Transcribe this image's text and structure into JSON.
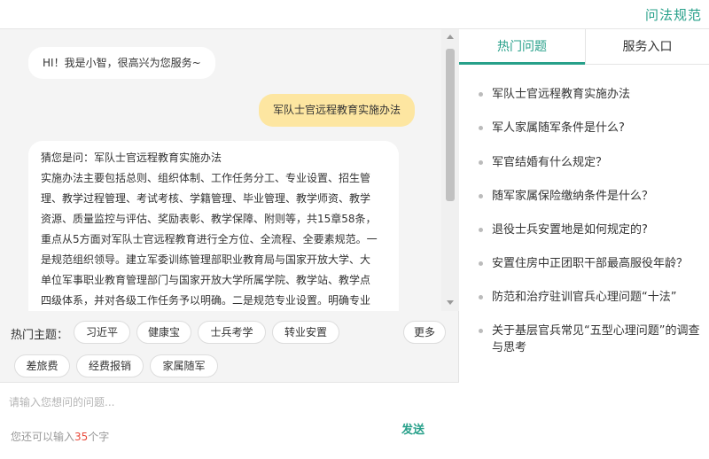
{
  "header": {
    "title": "问法规范"
  },
  "chat": {
    "greeting": "HI！我是小智，很高兴为您服务~",
    "user_query": "军队士官远程教育实施办法",
    "answer_lines": [
      "猜您是问：军队士官远程教育实施办法",
      "实施办法主要包括总则、组织体制、工作任务分工、专业设置、招生管",
      "理、教学过程管理、考试考核、学籍管理、毕业管理、教学师资、教学",
      "资源、质量监控与评估、奖励表彰、教学保障、附则等，共15章58条，",
      "重点从5方面对军队士官远程教育进行全方位、全流程、全要素规范。一",
      "是规范组织领导。建立军委训练管理部职业教育局与国家开放大学、大",
      "单位军事职业教育管理部门与国家开放大学所属学院、教学站、教学点",
      "四级体系，并对各级工作任务予以明确。二是规范专业设置。明确专业"
    ]
  },
  "topics": {
    "label": "热门主题：",
    "items": [
      "习近平",
      "健康宝",
      "士兵考学",
      "转业安置",
      "差旅费",
      "经费报销",
      "家属随军"
    ],
    "more": "更多"
  },
  "input": {
    "placeholder": "请输入您想问的问题...",
    "counter_prefix": "您还可以输入",
    "counter_value": "35",
    "counter_suffix": "个字",
    "send_label": "发送"
  },
  "side": {
    "tabs": [
      "热门问题",
      "服务入口"
    ],
    "active_tab": 0,
    "questions": [
      "军队士官远程教育实施办法",
      "军人家属随军条件是什么?",
      "军官结婚有什么规定？",
      "随军家属保险缴纳条件是什么？",
      "退役士兵安置地是如何规定的?",
      "安置住房中正团职干部最高服役年龄？",
      "防范和治疗驻训官兵心理问题“十法”",
      "关于基层官兵常见“五型心理问题”的调查与思考"
    ]
  },
  "colors": {
    "accent": "#27a08a",
    "user_bubble": "#fde6a1",
    "counter_highlight": "#e94b3c"
  }
}
